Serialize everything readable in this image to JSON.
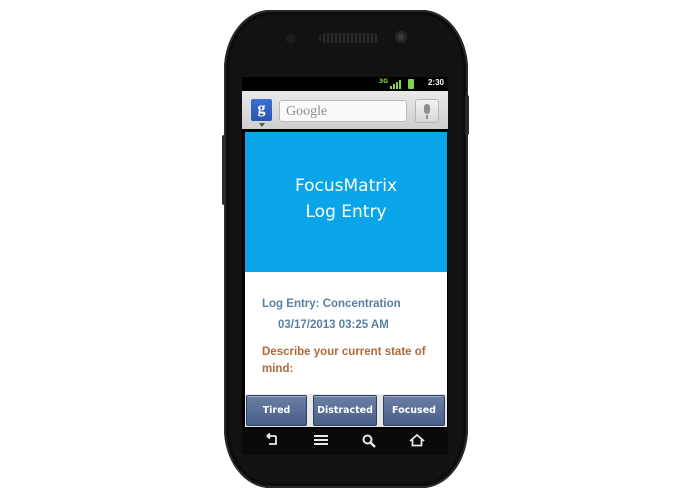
{
  "status_bar": {
    "network": "3G",
    "time": "2:30"
  },
  "search_bar": {
    "google_button_label": "g",
    "placeholder": "Google"
  },
  "header": {
    "title_line1": "FocusMatrix",
    "title_line2": "Log Entry"
  },
  "entry": {
    "label": "Log Entry: Concentration",
    "date": "03/17/2013 03:25 AM",
    "prompt": "Describe your current state of mind:"
  },
  "buttons": [
    {
      "label": "Tired"
    },
    {
      "label": "Distracted"
    },
    {
      "label": "Focused"
    }
  ],
  "nav_bar": {
    "icons": [
      "back-icon",
      "menu-icon",
      "search-icon",
      "home-icon"
    ]
  },
  "colors": {
    "header_bg": "#0aa5e9",
    "entry_text": "#5a7fa1",
    "prompt_text": "#b2683a",
    "button_bg": "#5a6f98"
  }
}
